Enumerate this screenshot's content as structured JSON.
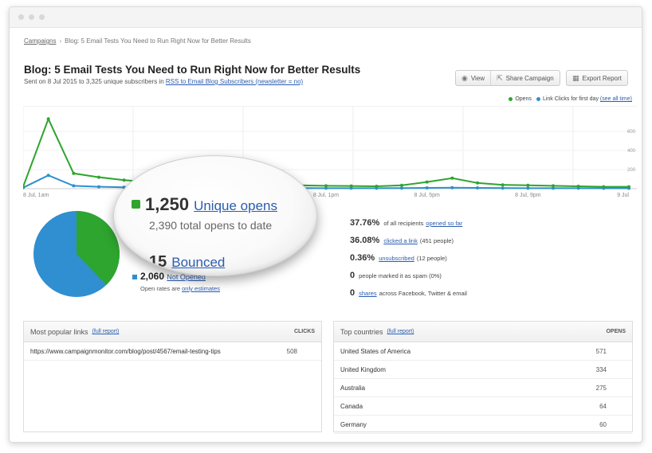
{
  "breadcrumb": {
    "root": "Campaigns",
    "separator": "›",
    "current": "Blog: 5 Email Tests You Need to Run Right Now for Better Results"
  },
  "header": {
    "title": "Blog: 5 Email Tests You Need to Run Right Now for Better Results",
    "sent_prefix": "Sent on 8 Jul 2015 to 3,325 unique subscribers in ",
    "list_link": "RSS to Email Blog Subscribers (newsletter = no)"
  },
  "actions": {
    "view": "View",
    "share": "Share Campaign",
    "export": "Export Report"
  },
  "legend": {
    "opens": "Opens",
    "clicks": "Link Clicks for first day",
    "see_all": "(see all time)"
  },
  "colors": {
    "opens": "#2ea52e",
    "clicks": "#2f8fd0",
    "link": "#2a5db0"
  },
  "chart_data": {
    "type": "line",
    "x": [
      "8 Jul, 1am",
      "",
      "",
      "",
      "",
      "",
      "",
      "",
      "",
      "",
      "",
      "",
      "8 Jul, 1pm",
      "",
      "",
      "",
      "8 Jul, 5pm",
      "",
      "",
      "",
      "8 Jul, 9pm",
      "",
      "",
      "",
      "9 Jul"
    ],
    "x_ticks": [
      "8 Jul, 1am",
      "8 Jul, 1pm",
      "8 Jul, 5pm",
      "8 Jul, 9pm",
      "9 Jul"
    ],
    "y_ticks": [
      "600",
      "400",
      "200"
    ],
    "ylim": [
      0,
      800
    ],
    "series": [
      {
        "name": "Opens",
        "values": [
          20,
          730,
          160,
          120,
          90,
          70,
          60,
          50,
          45,
          40,
          38,
          35,
          30,
          28,
          25,
          35,
          70,
          110,
          60,
          40,
          35,
          30,
          25,
          20,
          20
        ]
      },
      {
        "name": "Link Clicks for first day",
        "values": [
          10,
          140,
          30,
          20,
          15,
          12,
          10,
          8,
          8,
          7,
          6,
          6,
          5,
          5,
          5,
          6,
          8,
          10,
          8,
          6,
          5,
          5,
          5,
          4,
          4
        ]
      }
    ]
  },
  "pie_data": {
    "opened": 1250,
    "not_opened": 2060,
    "bounced": 15
  },
  "magnifier": {
    "unique_opens_num": "1,250",
    "unique_opens_label": "Unique opens",
    "total_opens": "2,390 total opens to date",
    "bounced_num": "15",
    "bounced_label": "Bounced"
  },
  "not_opened": {
    "num": "2,060",
    "label": "Not Opened"
  },
  "estimate": {
    "prefix": "Open rates are ",
    "link": "only estimates"
  },
  "stats": [
    {
      "value": "37.76%",
      "pre": "of all recipients",
      "link": "opened so far",
      "post": ""
    },
    {
      "value": "36.08%",
      "pre": "",
      "link": "clicked a link",
      "post": "(451 people)"
    },
    {
      "value": "0.36%",
      "pre": "",
      "link": "unsubscribed",
      "post": "(12 people)"
    },
    {
      "value": "0",
      "pre": "people marked it as spam (0%)",
      "link": "",
      "post": ""
    },
    {
      "value": "0",
      "pre": "",
      "link": "shares",
      "post": "across Facebook, Twitter & email"
    }
  ],
  "popular_links": {
    "title": "Most popular links",
    "full_report": "(full report)",
    "col": "CLICKS",
    "rows": [
      {
        "url": "https://www.campaignmonitor.com/blog/post/4567/email-testing-tips",
        "clicks": "508"
      }
    ]
  },
  "top_countries": {
    "title": "Top countries",
    "full_report": "(full report)",
    "col": "OPENS",
    "rows": [
      {
        "country": "United States of America",
        "opens": "571"
      },
      {
        "country": "United Kingdom",
        "opens": "334"
      },
      {
        "country": "Australia",
        "opens": "275"
      },
      {
        "country": "Canada",
        "opens": "64"
      },
      {
        "country": "Germany",
        "opens": "60"
      }
    ]
  }
}
